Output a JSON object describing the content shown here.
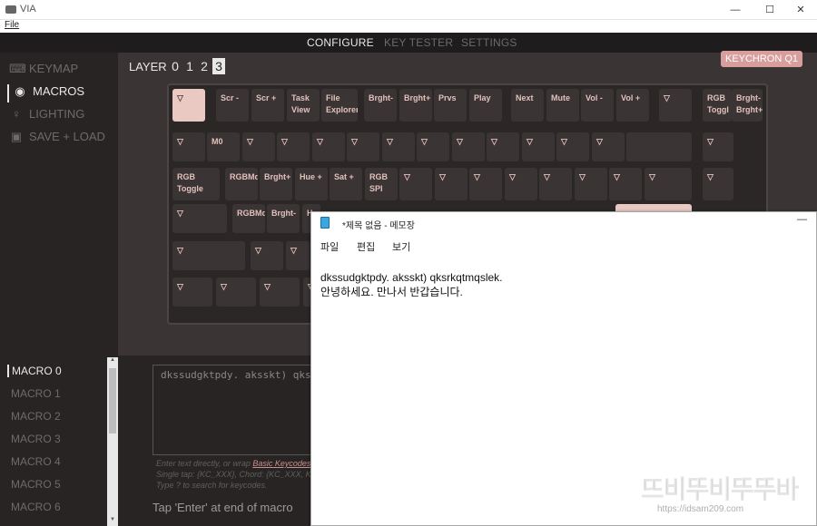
{
  "window": {
    "title": "VIA",
    "minimize": "—",
    "maximize": "☐",
    "close": "✕",
    "menu_file": "File"
  },
  "topnav": {
    "tabs": [
      "CONFIGURE",
      "KEY TESTER",
      "SETTINGS"
    ]
  },
  "sidebar": {
    "items": [
      {
        "label": "KEYMAP",
        "icon": "keyboard-icon"
      },
      {
        "label": "MACROS",
        "icon": "target-icon"
      },
      {
        "label": "LIGHTING",
        "icon": "bulb-icon"
      },
      {
        "label": "SAVE + LOAD",
        "icon": "floppy-icon"
      }
    ]
  },
  "layer": {
    "label": "LAYER",
    "numbers": [
      "0",
      "1",
      "2",
      "3"
    ],
    "active": "3"
  },
  "keyboard_name": "KEYCHRON Q1",
  "keys": {
    "r0": [
      "▽",
      "Scr -",
      "Scr +",
      "Task View",
      "File Explorer",
      "Brght-",
      "Brght+",
      "Prvs",
      "Play",
      "Next",
      "Mute",
      "Vol -",
      "Vol +",
      "▽",
      "RGB Toggl",
      "Brght- Brght+"
    ],
    "r1": [
      "▽",
      "M0",
      "▽",
      "▽",
      "▽",
      "▽",
      "▽",
      "▽",
      "▽",
      "▽",
      "▽",
      "▽",
      "▽",
      "",
      "▽"
    ],
    "r2": [
      "RGB Toggle",
      "RGBMd-",
      "Brght+",
      "Hue +",
      "Sat +",
      "RGB SPI",
      "▽",
      "▽",
      "▽",
      "▽",
      "▽",
      "▽",
      "▽",
      "▽",
      "▽"
    ],
    "r3": [
      "▽",
      "RGBMd-",
      "Brght-",
      "H"
    ],
    "r4": [
      "▽",
      "▽",
      "▽"
    ],
    "r5": [
      "▽",
      "▽",
      "▽",
      "▽"
    ]
  },
  "macros": {
    "list": [
      "MACRO 0",
      "MACRO 1",
      "MACRO 2",
      "MACRO 3",
      "MACRO 4",
      "MACRO 5",
      "MACRO 6"
    ],
    "active": "MACRO 0",
    "text_value": "dkssudgktpdy. aksskt) qks",
    "hint_prefix": "Enter text directly, or wrap ",
    "hint_link": "Basic Keycodes",
    "hint_line2": "Single tap: {KC_XXX}, Chord: {KC_XXX, KC_",
    "hint_line3": "Type ? to search for keycodes.",
    "footer": "Tap 'Enter' at end of macro"
  },
  "notepad": {
    "title": "*제목 없음 - 메모장",
    "menu": [
      "파일",
      "편집",
      "보기"
    ],
    "lines": [
      "dkssudgktpdy. aksskt) qksrkqtmqslek.",
      "안녕하세요. 만나서 반갑습니다."
    ]
  },
  "watermark": {
    "brand": "뜨비뚜비뚜뚜바",
    "url": "https://idsam209.com"
  }
}
